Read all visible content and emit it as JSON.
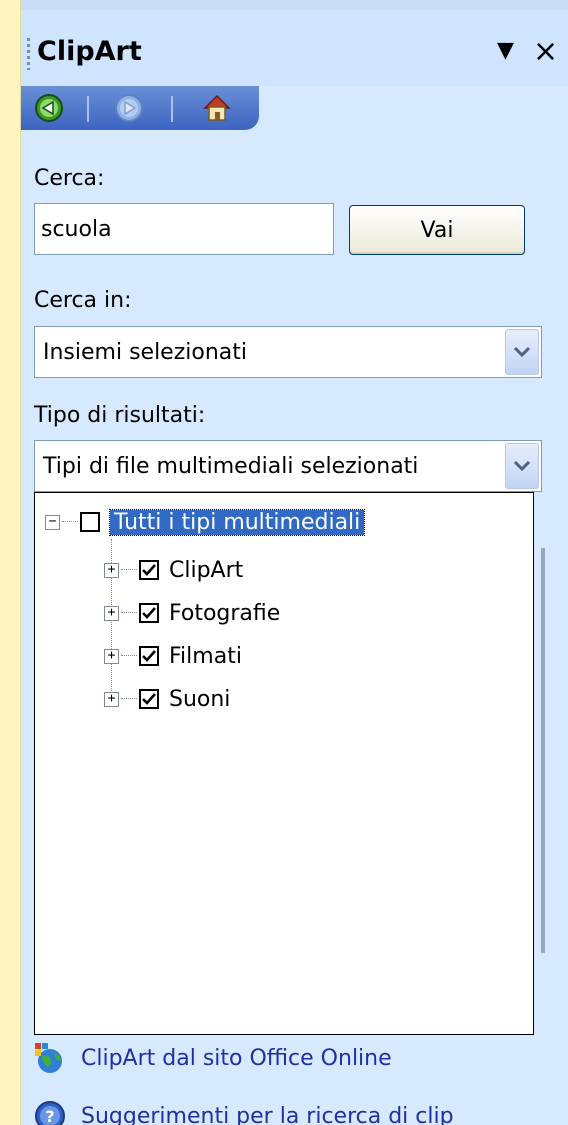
{
  "window": {
    "title": "ClipArt"
  },
  "search": {
    "label": "Cerca:",
    "value": "scuola",
    "go_label": "Vai"
  },
  "search_in": {
    "label": "Cerca in:",
    "selected": "Insiemi selezionati"
  },
  "result_type": {
    "label": "Tipo di risultati:",
    "selected": "Tipi di file multimediali selezionati"
  },
  "tree": {
    "root": {
      "label": "Tutti i tipi multimediali",
      "checked": false
    },
    "children": [
      {
        "label": "ClipArt",
        "checked": true
      },
      {
        "label": "Fotografie",
        "checked": true
      },
      {
        "label": "Filmati",
        "checked": true
      },
      {
        "label": "Suoni",
        "checked": true
      }
    ]
  },
  "links": {
    "online": "ClipArt dal sito Office Online",
    "tips": "Suggerimenti per la ricerca di clip"
  },
  "icons": {
    "dropdown": "dropdown-arrow-icon",
    "close": "close-icon",
    "back": "back-arrow-icon",
    "forward": "forward-arrow-icon",
    "home": "home-icon",
    "online": "globe-icon",
    "tips": "help-icon"
  },
  "colors": {
    "panel_bg": "#d6e9ff",
    "nav_bar": "#3c64c0",
    "selection": "#316ac5",
    "link": "#2030a0"
  }
}
